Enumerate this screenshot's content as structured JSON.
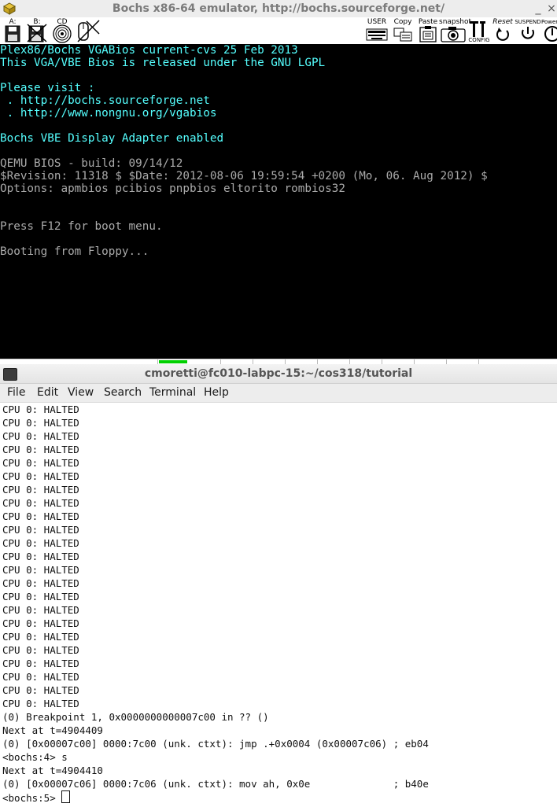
{
  "bochs": {
    "title": "Bochs x86-64 emulator, http://bochs.sourceforge.net/",
    "toolbar": {
      "floppy_a_label": "A:",
      "floppy_b_label": "B:",
      "cdrom_label": "CD",
      "user_label": "USER",
      "copy_label": "Copy",
      "paste_label": "Paste",
      "snapshot_label": "snapshot",
      "config_label": "CONFIG",
      "reset_label": "Reset",
      "suspend_label": "SUSPEND",
      "power_label": "Power"
    },
    "screen_lines": [
      {
        "text": "Plex86/Bochs VGABios current-cvs 25 Feb 2013",
        "color": "cyan"
      },
      {
        "text": "This VGA/VBE Bios is released under the GNU LGPL",
        "color": "cyan"
      },
      {
        "text": "",
        "color": "cyan"
      },
      {
        "text": "Please visit :",
        "color": "cyan"
      },
      {
        "text": " . http://bochs.sourceforge.net",
        "color": "cyan"
      },
      {
        "text": " . http://www.nongnu.org/vgabios",
        "color": "cyan"
      },
      {
        "text": "",
        "color": "cyan"
      },
      {
        "text": "Bochs VBE Display Adapter enabled",
        "color": "cyan"
      },
      {
        "text": "",
        "color": "gray"
      },
      {
        "text": "QEMU BIOS - build: 09/14/12",
        "color": "gray"
      },
      {
        "text": "$Revision: 11318 $ $Date: 2012-08-06 19:59:54 +0200 (Mo, 06. Aug 2012) $",
        "color": "gray"
      },
      {
        "text": "Options: apmbios pcibios pnpbios eltorito rombios32",
        "color": "gray"
      },
      {
        "text": "",
        "color": "gray"
      },
      {
        "text": "",
        "color": "gray"
      },
      {
        "text": "Press F12 for boot menu.",
        "color": "gray"
      },
      {
        "text": "",
        "color": "gray"
      },
      {
        "text": "Booting from Floppy...",
        "color": "gray"
      }
    ],
    "colors": {
      "cyan": "#55ffff",
      "gray": "#aaaaaa",
      "led_active": "#00d000"
    }
  },
  "terminal": {
    "title": "cmoretti@fc010-labpc-15:~/cos318/tutorial",
    "menu": [
      "File",
      "Edit",
      "View",
      "Search",
      "Terminal",
      "Help"
    ],
    "lines": [
      "CPU 0: HALTED",
      "CPU 0: HALTED",
      "CPU 0: HALTED",
      "CPU 0: HALTED",
      "CPU 0: HALTED",
      "CPU 0: HALTED",
      "CPU 0: HALTED",
      "CPU 0: HALTED",
      "CPU 0: HALTED",
      "CPU 0: HALTED",
      "CPU 0: HALTED",
      "CPU 0: HALTED",
      "CPU 0: HALTED",
      "CPU 0: HALTED",
      "CPU 0: HALTED",
      "CPU 0: HALTED",
      "CPU 0: HALTED",
      "CPU 0: HALTED",
      "CPU 0: HALTED",
      "CPU 0: HALTED",
      "CPU 0: HALTED",
      "CPU 0: HALTED",
      "CPU 0: HALTED",
      "(0) Breakpoint 1, 0x0000000000007c00 in ?? ()",
      "Next at t=4904409",
      "(0) [0x00007c00] 0000:7c00 (unk. ctxt): jmp .+0x0004 (0x00007c06) ; eb04",
      "<bochs:4> s",
      "Next at t=4904410",
      "(0) [0x00007c06] 0000:7c06 (unk. ctxt): mov ah, 0x0e              ; b40e"
    ],
    "prompt": "<bochs:5> "
  }
}
